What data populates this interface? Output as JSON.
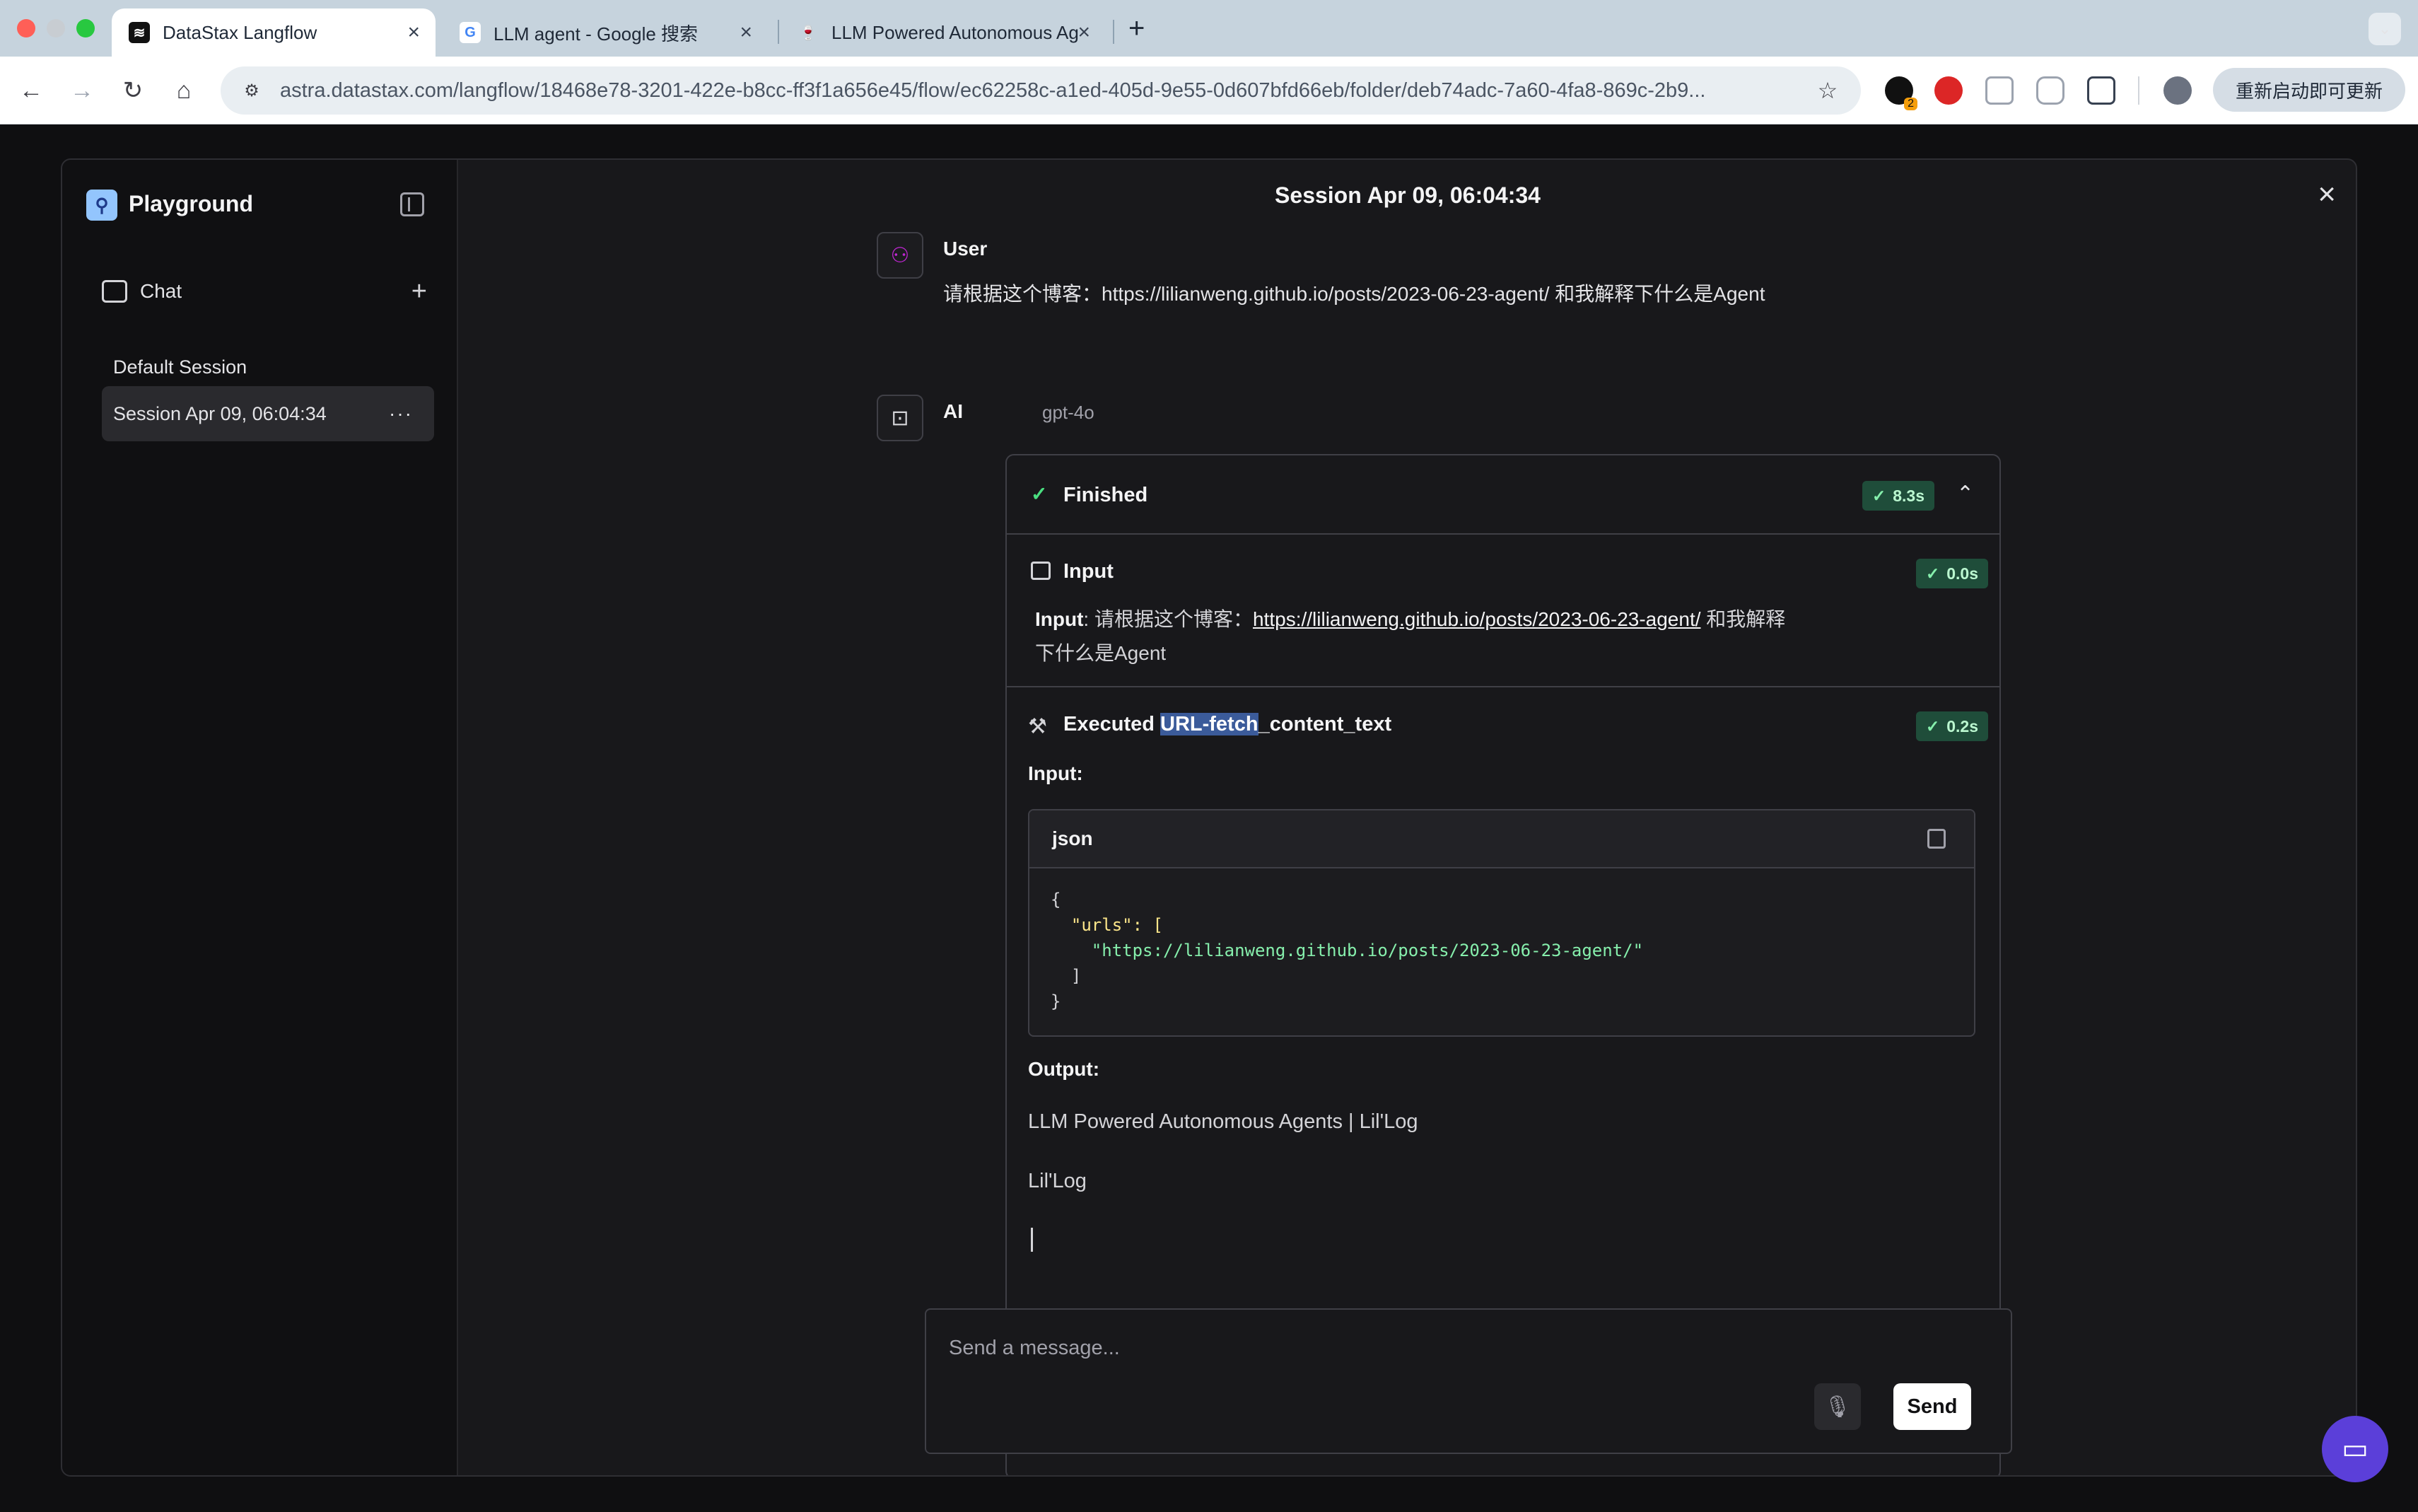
{
  "browser": {
    "tabs": [
      {
        "title": "DataStax Langflow",
        "active": true
      },
      {
        "title": "LLM agent - Google 搜索",
        "active": false
      },
      {
        "title": "LLM Powered Autonomous Ag",
        "active": false
      }
    ],
    "url": "astra.datastax.com/langflow/18468e78-3201-422e-b8cc-ff3f1a656e45/flow/ec62258c-a1ed-405d-9e55-0d607bfd66eb/folder/deb74adc-7a60-4fa8-869c-2b9...",
    "extension_badge": "2",
    "update_button": "重新启动即可更新"
  },
  "sidebar": {
    "title": "Playground",
    "chat_label": "Chat",
    "sessions": [
      {
        "label": "Default Session",
        "active": false
      },
      {
        "label": "Session Apr 09, 06:04:34",
        "active": true
      }
    ]
  },
  "main": {
    "session_title": "Session Apr 09, 06:04:34",
    "user_message": {
      "sender": "User",
      "text": "请根据这个博客：https://lilianweng.github.io/posts/2023-06-23-agent/ 和我解释下什么是Agent"
    },
    "ai_message": {
      "sender": "AI",
      "model": "gpt-4o",
      "status": "Finished",
      "status_time": "8.3s",
      "steps": {
        "input": {
          "title": "Input",
          "time": "0.0s",
          "label": "Input",
          "prefix": ": 请根据这个博客：",
          "link": "https://lilianweng.github.io/posts/2023-06-23-agent/",
          "suffix_line1": " 和我解释",
          "suffix_line2": "下什么是Agent"
        },
        "tool": {
          "executed_label": "Executed",
          "tool_name_highlight": "URL-fetch",
          "tool_name_rest": "_content_text",
          "time": "0.2s",
          "input_label": "Input:",
          "code_lang": "json",
          "code_lines": [
            "{",
            "  \"urls\": [",
            "    \"https://lilianweng.github.io/posts/2023-06-23-agent/\"",
            "  ]",
            "}"
          ],
          "output_label": "Output:",
          "output_lines": [
            "LLM Powered Autonomous Agents | Lil'Log",
            "Lil'Log"
          ]
        }
      }
    }
  },
  "composer": {
    "placeholder": "Send a message...",
    "send_label": "Send"
  },
  "colors": {
    "accent_green": "#1f4d3a",
    "logo_blue": "#93c5fd",
    "help_purple": "#5b3fd9"
  }
}
